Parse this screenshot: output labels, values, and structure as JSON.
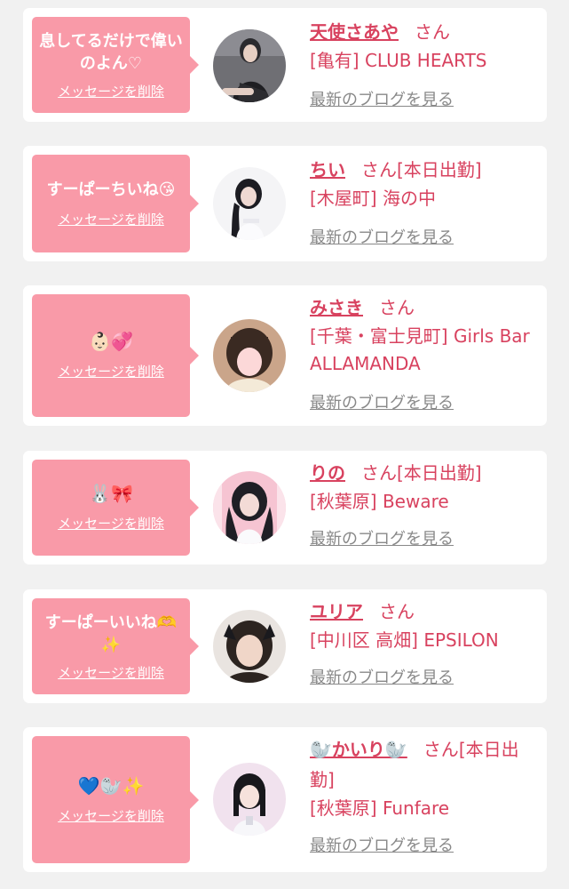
{
  "colors": {
    "background": "#f1f1f1",
    "card": "#ffffff",
    "bubble": "#f99aa8",
    "accent_text": "#d8425f",
    "link_gray": "#888888"
  },
  "messages": [
    {
      "message": "息してるだけで偉いのよん♡",
      "delete_label": "メッセージを削除",
      "name": "天使さあや",
      "honorific": "さん",
      "status": "",
      "shop": "[亀有] CLUB HEARTS",
      "blog_link": "最新のブログを見る"
    },
    {
      "message": "すーぱーちいね😘",
      "delete_label": "メッセージを削除",
      "name": "ちい",
      "honorific": "さん",
      "status": "[本日出勤]",
      "shop": "[木屋町] 海の中",
      "blog_link": "最新のブログを見る"
    },
    {
      "message": "👶🏻💞",
      "delete_label": "メッセージを削除",
      "name": "みさき",
      "honorific": "さん",
      "status": "",
      "shop": "[千葉・富士見町] Girls Bar ALLAMANDA",
      "blog_link": "最新のブログを見る"
    },
    {
      "message": "🐰🎀",
      "delete_label": "メッセージを削除",
      "name": "りの",
      "honorific": "さん",
      "status": "[本日出勤]",
      "shop": "[秋葉原] Beware",
      "blog_link": "最新のブログを見る"
    },
    {
      "message": "すーぱーいいね🫶✨",
      "delete_label": "メッセージを削除",
      "name": "ユリア",
      "honorific": "さん",
      "status": "",
      "shop": "[中川区 高畑] EPSILON",
      "blog_link": "最新のブログを見る"
    },
    {
      "message": "💙🦭✨",
      "delete_label": "メッセージを削除",
      "name": "🦭かいり🦭",
      "honorific": "さん",
      "status": "[本日出勤]",
      "shop": "[秋葉原] Funfare",
      "blog_link": "最新のブログを見る"
    }
  ]
}
